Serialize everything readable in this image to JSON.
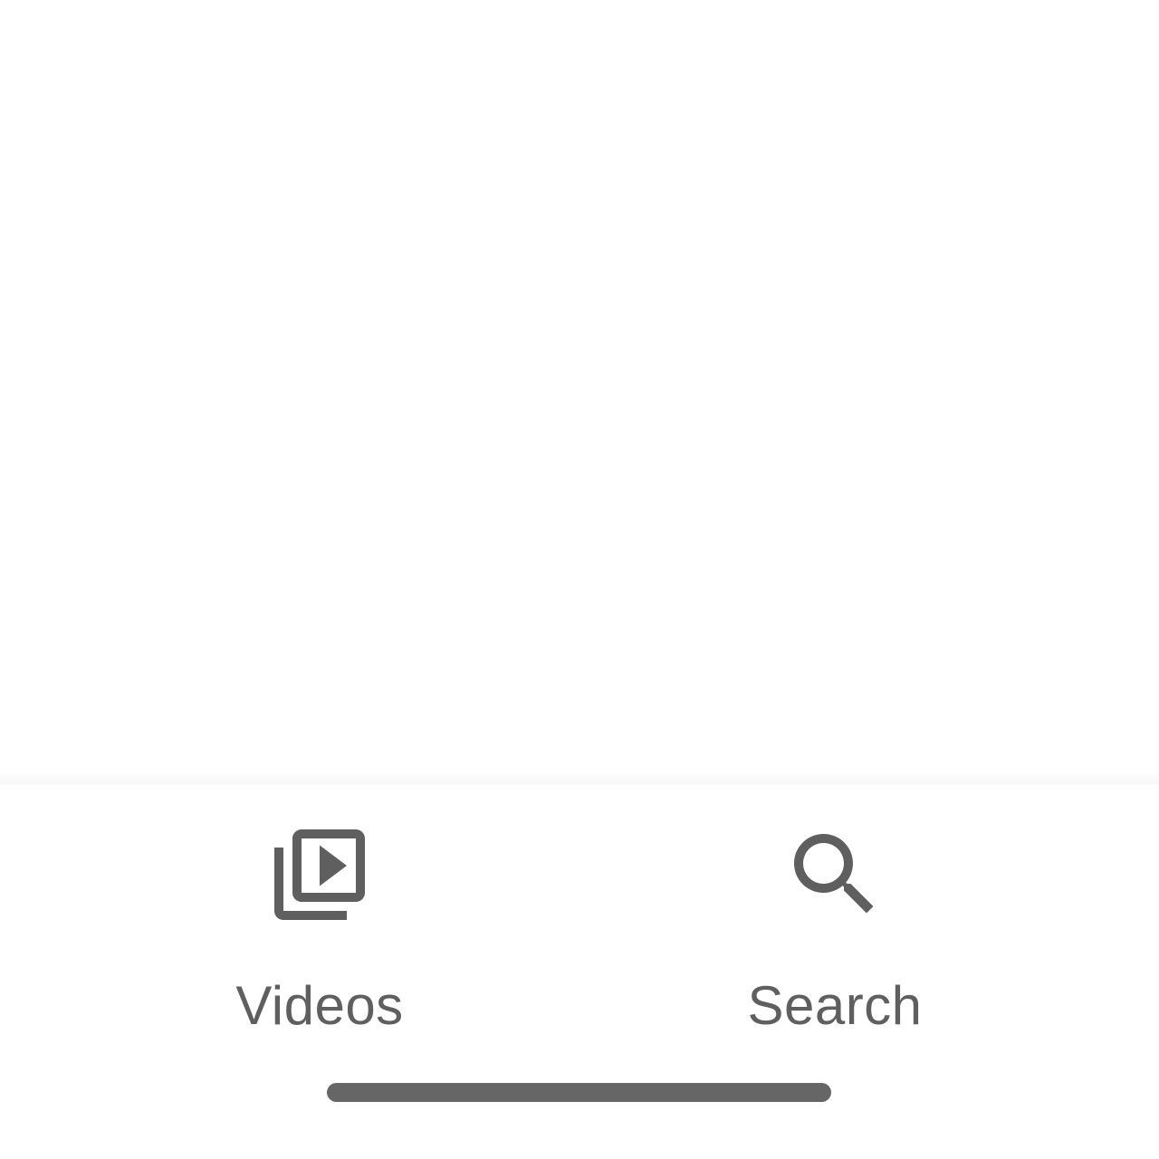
{
  "colors": {
    "icon": "#5f5f5f",
    "label": "#5f5f5f",
    "background": "#ffffff",
    "home_indicator": "#666666"
  },
  "bottom_nav": {
    "items": [
      {
        "label": "Videos",
        "icon": "video-library-icon"
      },
      {
        "label": "Search",
        "icon": "search-icon"
      }
    ]
  }
}
